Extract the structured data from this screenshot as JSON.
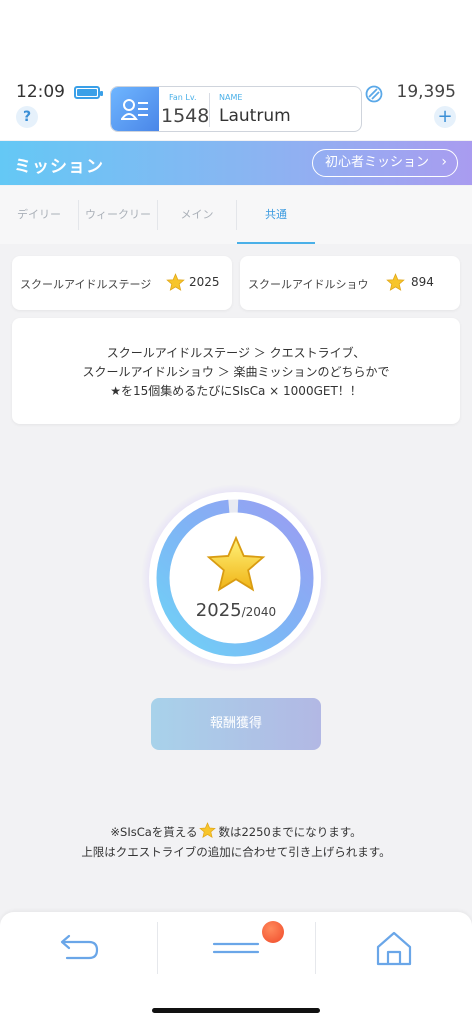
{
  "status": {
    "time": "12:09"
  },
  "header": {
    "help_icon": "question-icon",
    "fan_label": "Fan Lv.",
    "fan_level": "1548",
    "name_label": "NAME",
    "name": "Lautrum",
    "currency_icon": "gem-icon",
    "currency": "19,395",
    "add_icon": "plus-icon"
  },
  "titlebar": {
    "title": "ミッション",
    "beginner_button": "初心者ミッション"
  },
  "tabs": [
    {
      "label": "デイリー",
      "active": false
    },
    {
      "label": "ウィークリー",
      "active": false
    },
    {
      "label": "メイン",
      "active": false
    },
    {
      "label": "共通",
      "active": true
    }
  ],
  "stats": [
    {
      "label": "スクールアイドルステージ",
      "value": "2025"
    },
    {
      "label": "スクールアイドルショウ",
      "value": "894"
    }
  ],
  "description": {
    "line1": "スクールアイドルステージ ＞ クエストライブ、",
    "line2": "スクールアイドルショウ ＞ 楽曲ミッションのどちらかで",
    "line3": "★を15個集めるたびにSIsCa × 1000GET！！"
  },
  "progress": {
    "current": "2025",
    "max": "/2040",
    "fraction": 0.9926
  },
  "reward_button": "報酬獲得",
  "note": {
    "line1_before": "※SIsCaを貰える",
    "line1_after": "数は2250までになります。",
    "line2": "上限はクエストライブの追加に合わせて引き上げられます。"
  },
  "nav": {
    "back_icon": "back-arrow-icon",
    "menu_icon": "menu-icon",
    "home_icon": "home-icon"
  },
  "colors": {
    "accent": "#4ab0e8",
    "title_gradient_start": "#64c8f5",
    "title_gradient_end": "#a99cf0",
    "star": "#f7c52b",
    "badge": "#f04a2a"
  }
}
